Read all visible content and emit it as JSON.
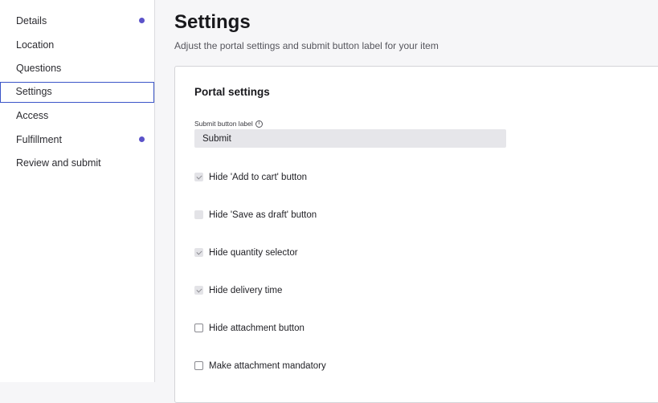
{
  "sidebar": {
    "items": [
      {
        "label": "Details",
        "dot": true
      },
      {
        "label": "Location",
        "dot": false
      },
      {
        "label": "Questions",
        "dot": false
      },
      {
        "label": "Settings",
        "dot": false,
        "active": true
      },
      {
        "label": "Access",
        "dot": false
      },
      {
        "label": "Fulfillment",
        "dot": true
      },
      {
        "label": "Review and submit",
        "dot": false
      }
    ],
    "dot_color": "#5b52c9",
    "active_border_color": "#3b55c8"
  },
  "main": {
    "title": "Settings",
    "subtitle": "Adjust the portal settings and submit button label for your item",
    "card": {
      "section_title": "Portal settings",
      "submit_label_field": {
        "label": "Submit button label",
        "value": "Submit",
        "icon": "info-icon"
      },
      "options": [
        {
          "label": "Hide 'Add to cart' button",
          "checked": true
        },
        {
          "label": "Hide 'Save as draft' button",
          "checked": false,
          "disabled": true
        },
        {
          "label": "Hide quantity selector",
          "checked": true
        },
        {
          "label": "Hide delivery time",
          "checked": true
        },
        {
          "label": "Hide attachment button",
          "checked": false
        },
        {
          "label": "Make attachment mandatory",
          "checked": false
        }
      ]
    }
  }
}
